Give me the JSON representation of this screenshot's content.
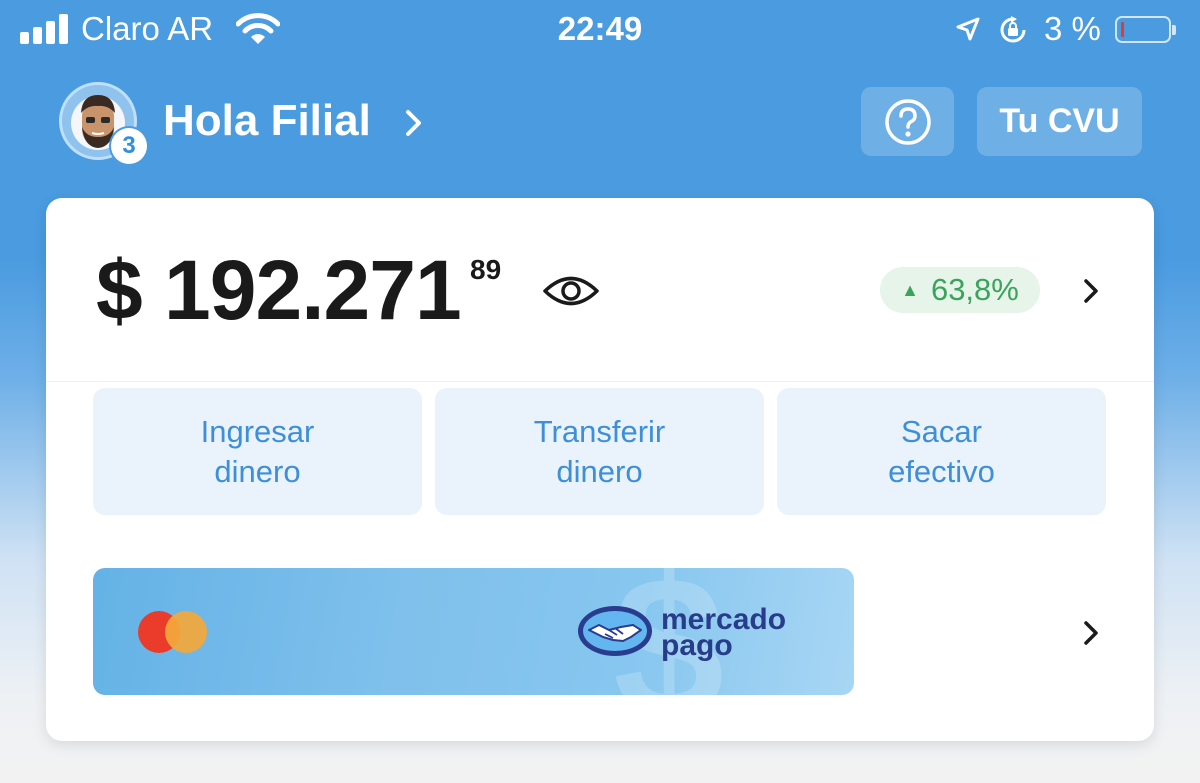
{
  "status_bar": {
    "carrier": "Claro AR",
    "time": "22:49",
    "battery_percent": "3 %",
    "battery_level": 0.03,
    "icons": [
      "signal-icon",
      "wifi-icon",
      "location-icon",
      "orientation-lock-icon",
      "battery-icon"
    ]
  },
  "header": {
    "greeting": "Hola Filial",
    "notification_count": "3",
    "help_icon": "question-icon",
    "cvu_label": "Tu CVU"
  },
  "balance": {
    "currency": "$",
    "amount": "$ 192.271",
    "cents": "89",
    "change": "63,8%",
    "change_direction": "up",
    "change_color": "#3aa35c"
  },
  "actions": [
    {
      "line1": "Ingresar",
      "line2": "dinero"
    },
    {
      "line1": "Transferir",
      "line2": "dinero"
    },
    {
      "line1": "Sacar",
      "line2": "efectivo"
    }
  ],
  "card_banner": {
    "network": "mastercard",
    "brand_line1": "mercado",
    "brand_line2": "pago"
  },
  "colors": {
    "header_bg": "#4a9be0",
    "accent": "#3d8fd8",
    "brand_navy": "#283c8c",
    "action_bg": "#eaf2fb"
  }
}
